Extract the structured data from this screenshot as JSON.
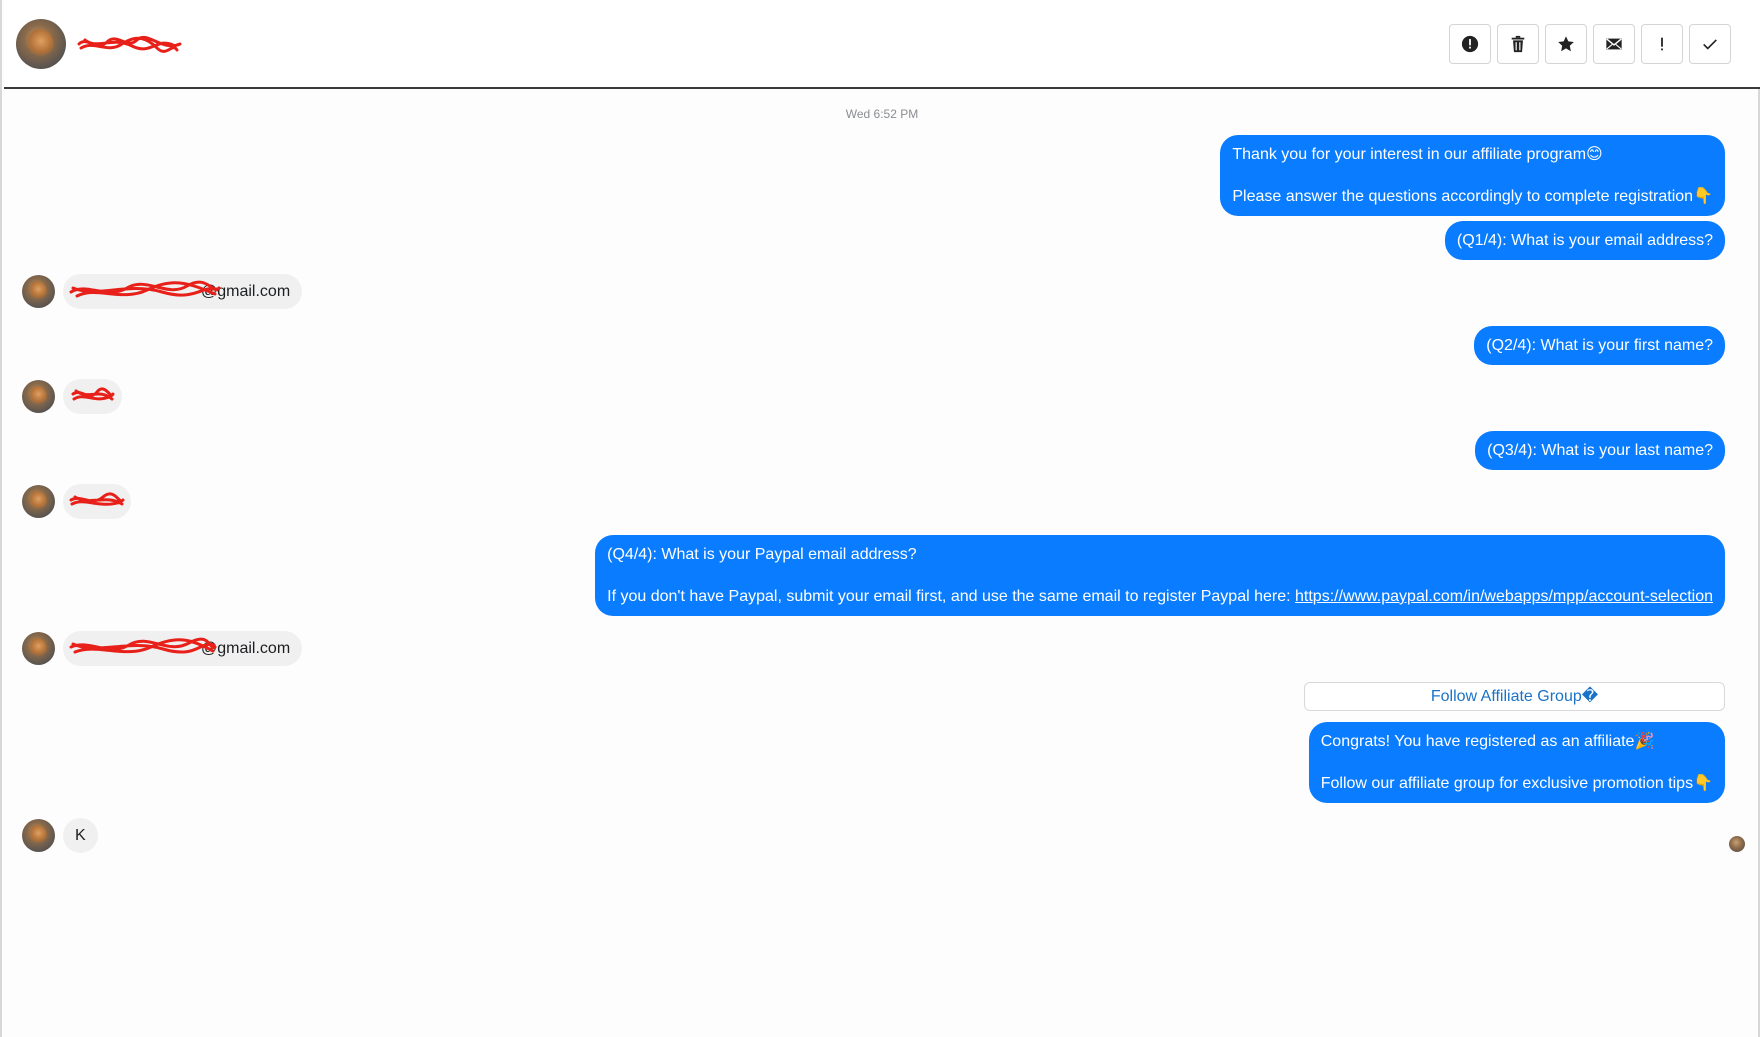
{
  "header": {
    "contact_name": "[redacted]",
    "toolbar": [
      {
        "name": "report-button",
        "icon": "alert-circle-icon"
      },
      {
        "name": "delete-button",
        "icon": "trash-icon"
      },
      {
        "name": "star-button",
        "icon": "star-icon"
      },
      {
        "name": "mark-unread-button",
        "icon": "envelope-icon"
      },
      {
        "name": "priority-button",
        "icon": "exclamation-icon"
      },
      {
        "name": "mark-done-button",
        "icon": "check-icon"
      }
    ]
  },
  "thread": {
    "timestamp": "Wed 6:52 PM",
    "m1": {
      "line1": "Thank you for your interest in our affiliate program😊",
      "line2": "Please answer the questions accordingly to complete registration👇"
    },
    "q1": "(Q1/4): What is your email address?",
    "r1": "@gmail.com",
    "q2": "(Q2/4): What is your first name?",
    "r2": "",
    "q3": "(Q3/4): What is your last name?",
    "r3": "",
    "q4": {
      "line1": "(Q4/4): What is your Paypal email address?",
      "line2_prefix": "If you don't have Paypal, submit your email first, and use the same email to register Paypal here: ",
      "link": "https://www.paypal.com/in/webapps/mpp/account-selection"
    },
    "r4": "@gmail.com",
    "follow_button": "Follow Affiliate Group�",
    "m_final": {
      "line1": "Congrats! You have registered as an affiliate🎉",
      "line2": "Follow our affiliate group for exclusive promotion tips👇"
    },
    "r5": "K"
  },
  "colors": {
    "outgoing_bubble": "#0a7cff",
    "incoming_bubble": "#f0f0f0",
    "link_blue": "#1a73c8",
    "redaction_red": "#e8201a"
  }
}
